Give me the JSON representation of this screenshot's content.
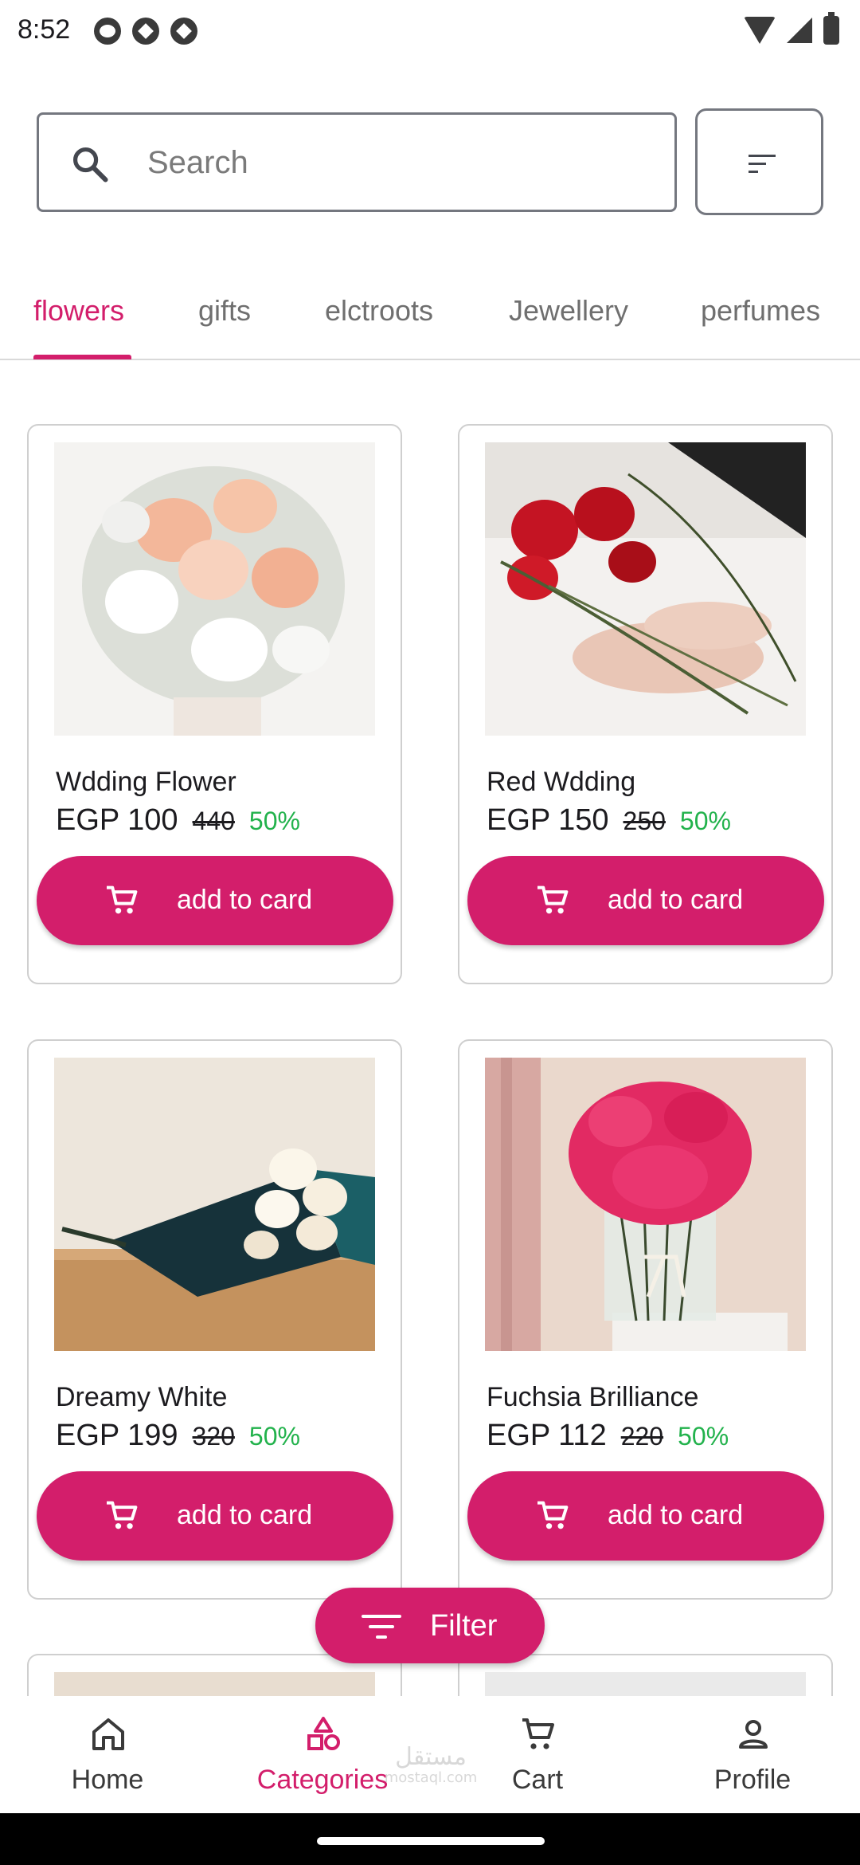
{
  "status_bar": {
    "time": "8:52"
  },
  "search": {
    "placeholder": "Search",
    "value": ""
  },
  "tabs": [
    {
      "label": "flowers",
      "active": true
    },
    {
      "label": "gifts",
      "active": false
    },
    {
      "label": "elctroots",
      "active": false
    },
    {
      "label": "Jewellery",
      "active": false
    },
    {
      "label": "perfumes",
      "active": false
    }
  ],
  "products": [
    {
      "name": "Wdding Flower",
      "price": "EGP 100",
      "old_price": "440",
      "discount": "50%",
      "button": "add to card"
    },
    {
      "name": "Red Wdding",
      "price": "EGP 150",
      "old_price": "250",
      "discount": "50%",
      "button": "add to card"
    },
    {
      "name": "Dreamy White",
      "price": "EGP 199",
      "old_price": "320",
      "discount": "50%",
      "button": "add to card"
    },
    {
      "name": "Fuchsia Brilliance",
      "price": "EGP 112",
      "old_price": "220",
      "discount": "50%",
      "button": "add to card"
    }
  ],
  "filter_button": {
    "label": "Filter"
  },
  "bottom_nav": [
    {
      "label": "Home",
      "icon": "home-icon",
      "active": false
    },
    {
      "label": "Categories",
      "icon": "categories-icon",
      "active": true
    },
    {
      "label": "Cart",
      "icon": "cart-icon",
      "active": false
    },
    {
      "label": "Profile",
      "icon": "profile-icon",
      "active": false
    }
  ],
  "watermark": {
    "arabic": "مستقل",
    "latin": "mostaql.com"
  },
  "colors": {
    "accent": "#d31e6b",
    "discount": "#22b24c",
    "border": "#cfcfcf"
  }
}
